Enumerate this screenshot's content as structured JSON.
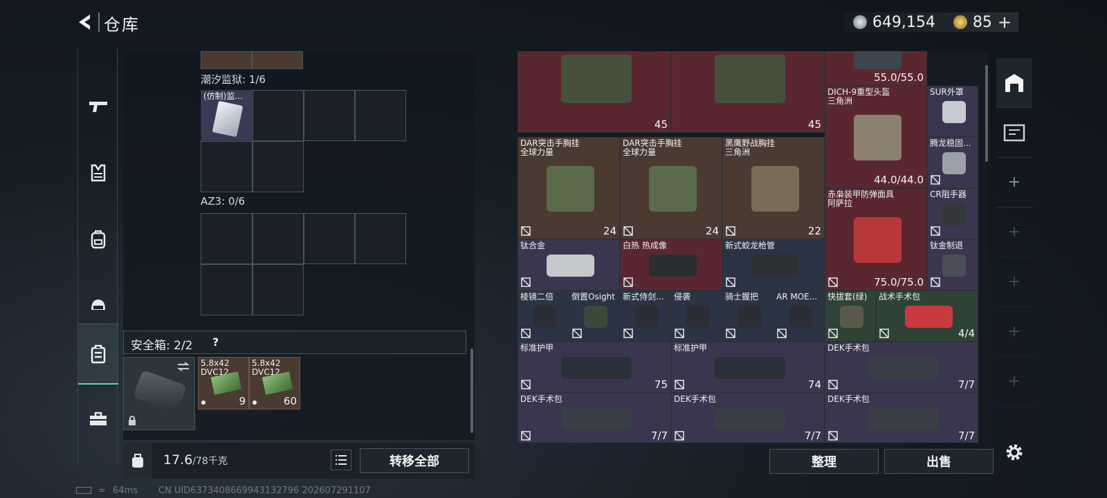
{
  "header": {
    "title": "仓库",
    "currency1": "649,154",
    "currency2": "85",
    "currency2_plus": "+"
  },
  "sidebar": {
    "items": [
      "pistol",
      "vest",
      "backpack",
      "helmet",
      "case",
      "toolbox"
    ],
    "active": "case"
  },
  "left": {
    "section1": "潮汐监狱: 1/6",
    "item1_name": "(仿制)监...",
    "section2": "AZ3: 0/6",
    "safebox_label": "安全箱: 2/2",
    "safebox_help": "?",
    "ammo1_name": "5.8x42\nDVC12",
    "ammo1_count": "9",
    "ammo2_name": "5.8x42\nDVC12",
    "ammo2_count": "60",
    "weight_value": "17.6",
    "weight_max": "/78千克",
    "transfer_all": "转移全部"
  },
  "right": {
    "items": [
      {
        "name": "",
        "count": "45"
      },
      {
        "name": "",
        "count": "45"
      },
      {
        "name": "",
        "count": "55.0/55.0"
      },
      {
        "name": "DICH-9重型头盔\n三角洲",
        "count": "44.0/44.0"
      },
      {
        "name": "SUR外罩",
        "count": ""
      },
      {
        "name": "DAR突击手胸挂\n全球力量",
        "count": "24"
      },
      {
        "name": "DAR突击手胸挂\n全球力量",
        "count": "24"
      },
      {
        "name": "黑鹰野战胸挂\n三角洲",
        "count": "22"
      },
      {
        "name": "腾龙稳固...",
        "count": ""
      },
      {
        "name": "赤枭装甲防弹面具\n阿萨拉",
        "count": "75.0/75.0"
      },
      {
        "name": "CR阻手器",
        "count": ""
      },
      {
        "name": "钛合金",
        "count": ""
      },
      {
        "name": "白热 热成像",
        "count": ""
      },
      {
        "name": "新式蛟龙枪管",
        "count": ""
      },
      {
        "name": "钛金制退",
        "count": ""
      },
      {
        "name": "棱镜二倍",
        "count": ""
      },
      {
        "name": "倒置Osight",
        "count": ""
      },
      {
        "name": "新式侍剑...",
        "count": ""
      },
      {
        "name": "侵袭",
        "count": ""
      },
      {
        "name": "骑士握把",
        "count": ""
      },
      {
        "name": "AR MOE...",
        "count": ""
      },
      {
        "name": "快拔套(绿)",
        "count": ""
      },
      {
        "name": "战术手术包",
        "count": "4/4"
      },
      {
        "name": "标准护甲",
        "count": "75"
      },
      {
        "name": "标准护甲",
        "count": "74"
      },
      {
        "name": "DEK手术包",
        "count": "7/7"
      },
      {
        "name": "DEK手术包",
        "count": "7/7"
      },
      {
        "name": "DEK手术包",
        "count": "7/7"
      },
      {
        "name": "DEK手术包",
        "count": "7/7"
      }
    ],
    "sort_button": "整理",
    "sell_button": "出售"
  },
  "status": {
    "ping": "64ms",
    "uid": "CN UID6373408669943132796 202607291107"
  },
  "colors": {
    "red_bg": "#5a2730",
    "blue_bg": "#2b3444",
    "purple_bg": "#3b3650",
    "gold_bg": "#4b3a32",
    "green_bg": "#2f4236",
    "teal_accent": "#5fd6b4"
  }
}
